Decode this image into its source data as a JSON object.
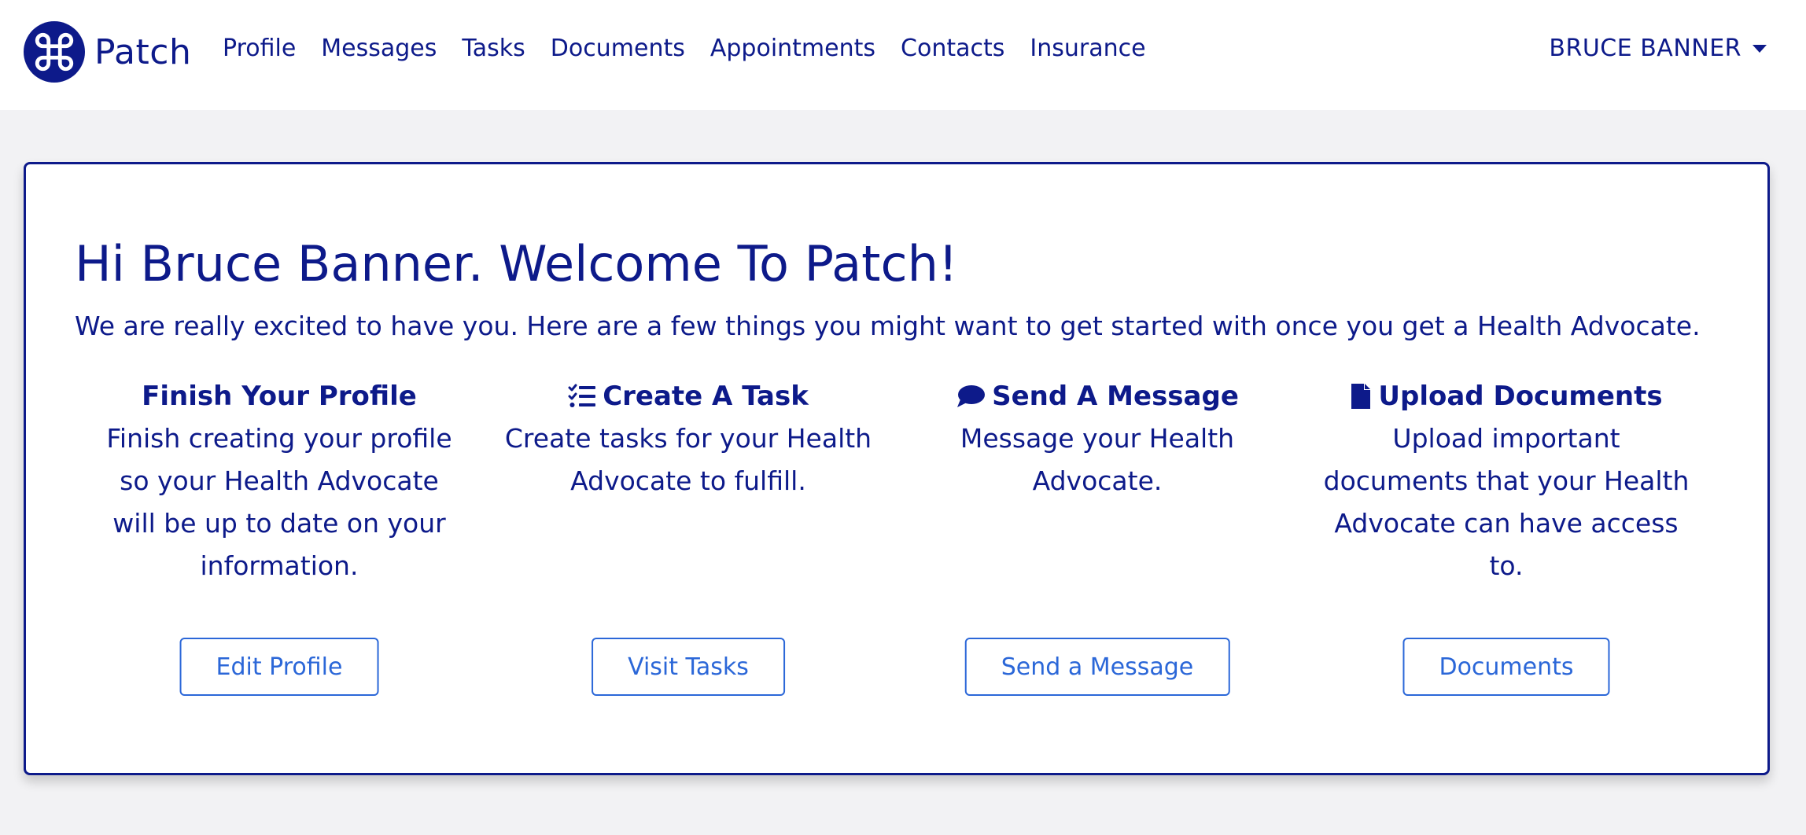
{
  "brand": {
    "name": "Patch",
    "logo_icon": "command-key-icon",
    "color": "#0d1a8a"
  },
  "nav": {
    "items": [
      {
        "label": "Profile"
      },
      {
        "label": "Messages"
      },
      {
        "label": "Tasks"
      },
      {
        "label": "Documents"
      },
      {
        "label": "Appointments"
      },
      {
        "label": "Contacts"
      },
      {
        "label": "Insurance"
      }
    ],
    "user": {
      "name": "BRUCE BANNER",
      "menu_icon": "caret-down-icon"
    }
  },
  "welcome": {
    "title": "Hi Bruce Banner. Welcome To Patch!",
    "subtitle": "We are really excited to have you. Here are a few things you might want to get started with once you get a Health Advocate."
  },
  "features": [
    {
      "icon": "",
      "title": "Finish Your Profile",
      "description": "Finish creating your profile so your Health Advocate will be up to date on your information.",
      "button": "Edit Profile"
    },
    {
      "icon": "tasks-icon",
      "title": "Create A Task",
      "description": "Create tasks for your Health Advocate to fulfill.",
      "button": "Visit Tasks"
    },
    {
      "icon": "comment-icon",
      "title": "Send A Message",
      "description": "Message your Health Advocate.",
      "button": "Send a Message"
    },
    {
      "icon": "file-icon",
      "title": "Upload Documents",
      "description": "Upload important documents that your Health Advocate can have access to.",
      "button": "Documents"
    }
  ],
  "colors": {
    "primary": "#0d1a8a",
    "button_blue": "#2b67d8",
    "background": "#f2f2f4"
  }
}
